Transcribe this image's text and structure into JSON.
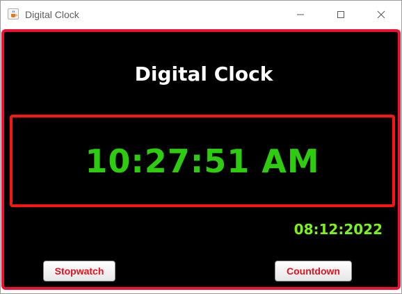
{
  "window": {
    "title": "Digital Clock",
    "icon": "java-cup-icon"
  },
  "clock": {
    "heading": "Digital Clock",
    "time": "10:27:51 AM",
    "date": "08:12:2022"
  },
  "buttons": {
    "stopwatch_label": "Stopwatch",
    "countdown_label": "Countdown"
  },
  "colors": {
    "frame_border": "#ee1133",
    "time_box_border": "#ff1414",
    "time_color": "#2ecc0e",
    "date_color": "#7cf21c",
    "button_text": "#e8101e",
    "background": "#000000"
  }
}
